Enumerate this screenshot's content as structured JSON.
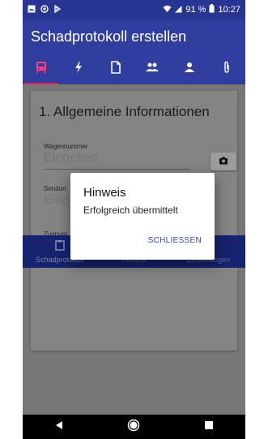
{
  "status_bar": {
    "battery": "91 %",
    "time": "10:27"
  },
  "app_bar": {
    "title": "Schadprotokoll erstellen"
  },
  "tabs": [
    {
      "icon": "train-icon",
      "active": true
    },
    {
      "icon": "flash-icon",
      "active": false
    },
    {
      "icon": "document-icon",
      "active": false
    },
    {
      "icon": "people-icon",
      "active": false
    },
    {
      "icon": "person-icon",
      "active": false
    },
    {
      "icon": "attachment-icon",
      "active": false
    }
  ],
  "form": {
    "section_title": "1. Allgemeine Informationen",
    "fields": [
      {
        "label": "Wagennummer",
        "placeholder": "Eingeben"
      },
      {
        "label": "Sendun",
        "placeholder": "Einge"
      },
      {
        "label": "Zugnum",
        "placeholder": ""
      }
    ]
  },
  "bottom_nav": [
    {
      "label": "Schadprotokoll",
      "icon": "clipboard-icon"
    },
    {
      "label": "Historie",
      "icon": "history-icon"
    },
    {
      "label": "Einstellungen",
      "icon": "gear-icon"
    }
  ],
  "dialog": {
    "title": "Hinweis",
    "message": "Erfolgreich übermittelt",
    "action": "SCHLIESSEN"
  },
  "colors": {
    "status_bar": "#283593",
    "primary": "#303f9f",
    "tab_indicator": "#e91e63",
    "dialog_action": "#3949ab"
  }
}
